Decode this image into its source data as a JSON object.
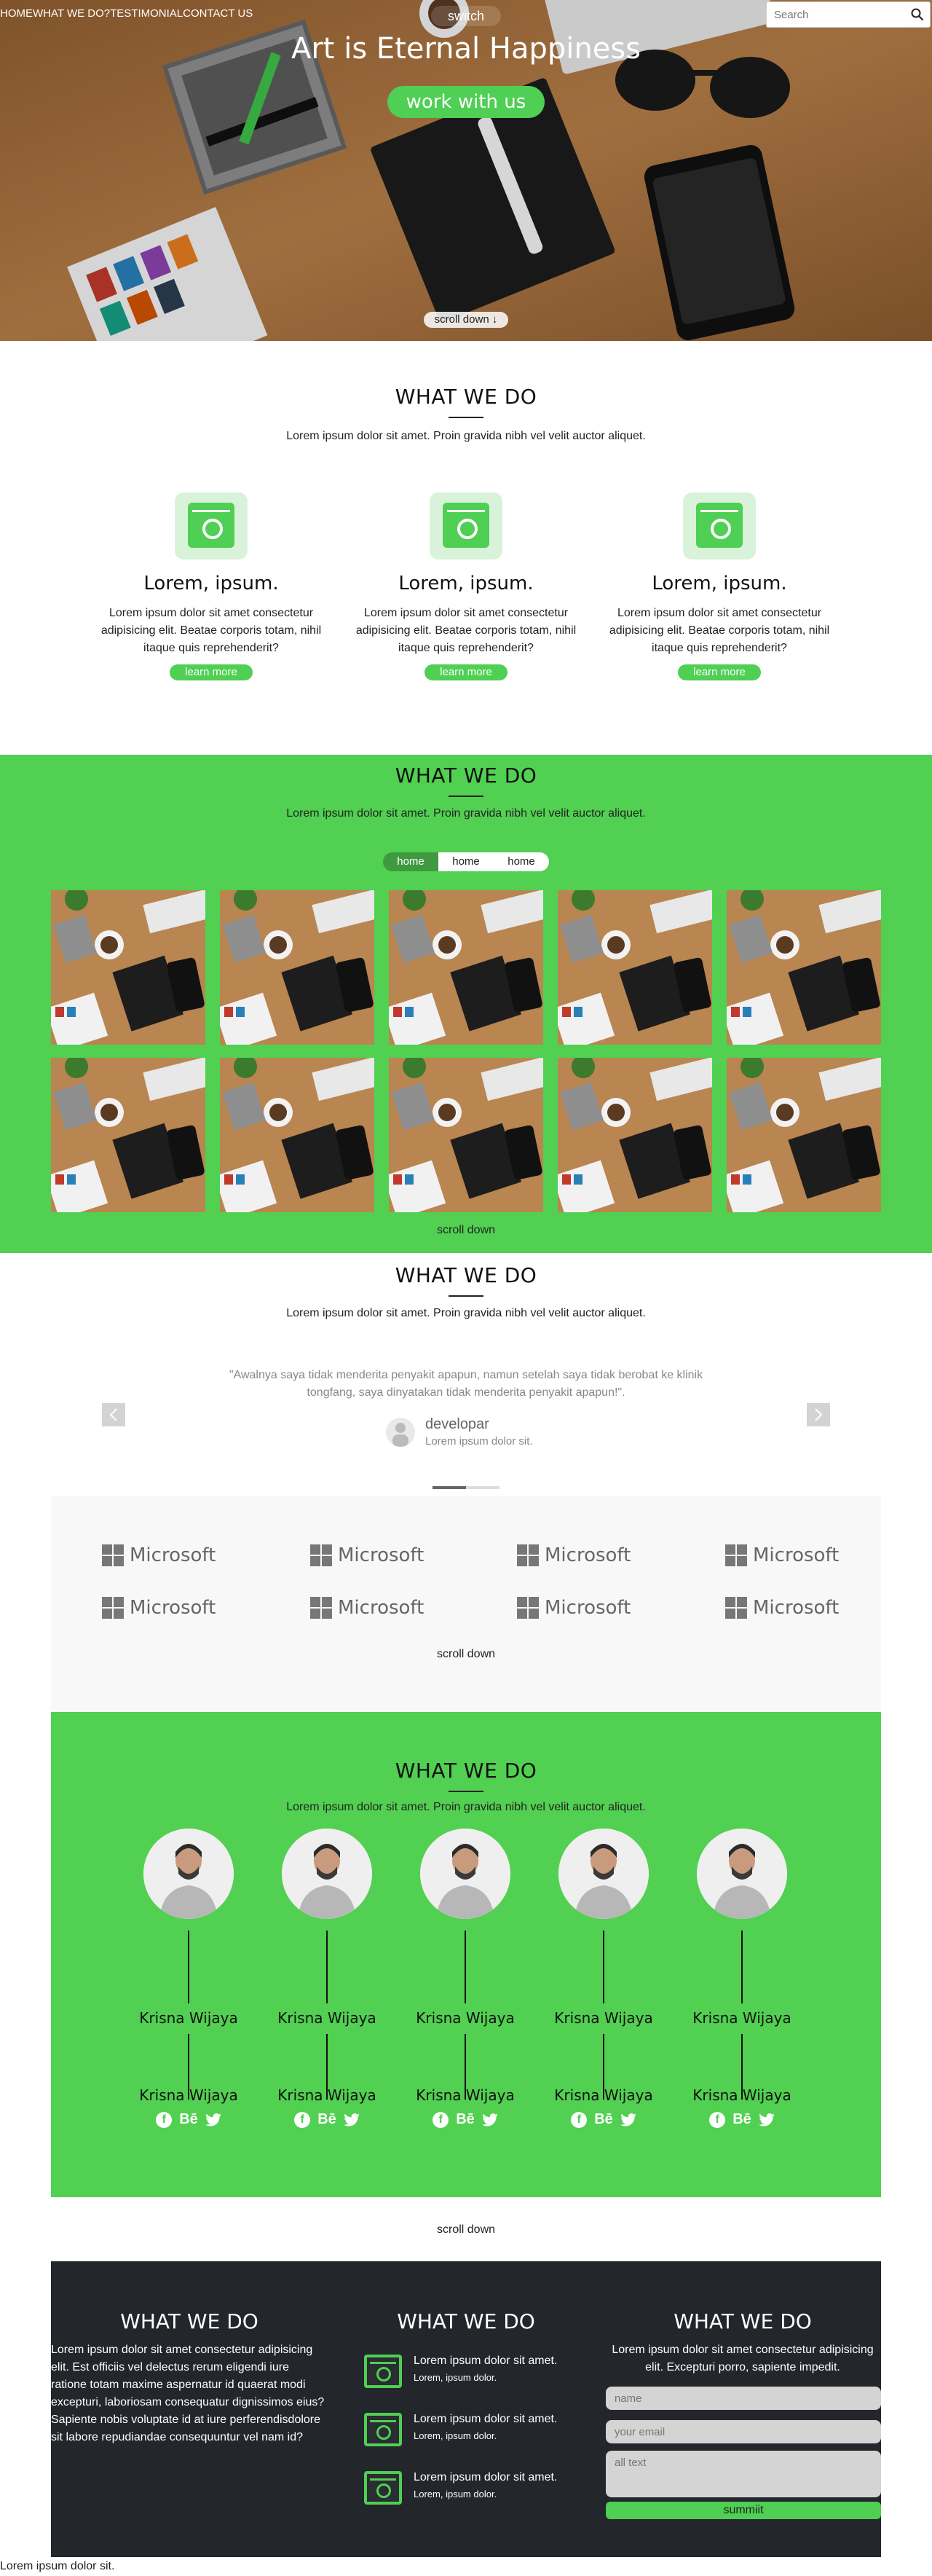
{
  "nav": {
    "links": [
      "HOME",
      "WHAT WE DO?",
      "TESTIMONIAL",
      "CONTACT US"
    ],
    "switch_label": "switch",
    "search_placeholder": "Search"
  },
  "hero": {
    "title": "Art is Eternal Happiness",
    "cta": "work with us",
    "scroll_label": "scroll down"
  },
  "services": {
    "title": "WHAT WE DO",
    "subtitle": "Lorem ipsum dolor sit amet. Proin gravida nibh vel velit auctor aliquet.",
    "items": [
      {
        "title": "Lorem, ipsum.",
        "text": "Lorem ipsum dolor sit amet consectetur adipisicing elit. Beatae corporis totam, nihil itaque quis reprehenderit?",
        "button": "learn more"
      },
      {
        "title": "Lorem, ipsum.",
        "text": "Lorem ipsum dolor sit amet consectetur adipisicing elit. Beatae corporis totam, nihil itaque quis reprehenderit?",
        "button": "learn more"
      },
      {
        "title": "Lorem, ipsum.",
        "text": "Lorem ipsum dolor sit amet consectetur adipisicing elit. Beatae corporis totam, nihil itaque quis reprehenderit?",
        "button": "learn more"
      }
    ]
  },
  "portfolio": {
    "title": "WHAT WE DO",
    "subtitle": "Lorem ipsum dolor sit amet. Proin gravida nibh vel velit auctor aliquet.",
    "filters": [
      "home",
      "home",
      "home"
    ],
    "active_filter": 0,
    "scroll_label": "scroll down"
  },
  "testimonial": {
    "title": "WHAT WE DO",
    "subtitle": "Lorem ipsum dolor sit amet. Proin gravida nibh vel velit auctor aliquet.",
    "quote": "\"Awalnya saya tidak menderita penyakit apapun, namun setelah saya tidak berobat ke klinik tongfang, saya dinyatakan tidak menderita penyakit apapun!\".",
    "name": "developar",
    "role": "Lorem ipsum dolor sit."
  },
  "clients": {
    "logo_text": "Microsoft",
    "scroll_label": "scroll down"
  },
  "team": {
    "title": "WHAT WE DO",
    "subtitle": "Lorem ipsum dolor sit amet. Proin gravida nibh vel velit auctor aliquet.",
    "members": [
      {
        "name_top": "Krisna Wijaya",
        "name_bottom": "Krisna Wijaya"
      },
      {
        "name_top": "Krisna Wijaya",
        "name_bottom": "Krisna Wijaya"
      },
      {
        "name_top": "Krisna Wijaya",
        "name_bottom": "Krisna Wijaya"
      },
      {
        "name_top": "Krisna Wijaya",
        "name_bottom": "Krisna Wijaya"
      },
      {
        "name_top": "Krisna Wijaya",
        "name_bottom": "Krisna Wijaya"
      }
    ],
    "behance_label": "Bē",
    "scroll_label": "scroll down"
  },
  "footer": {
    "col1_title": "WHAT WE DO",
    "col1_text": "Lorem ipsum dolor sit amet consectetur adipisicing elit. Est officiis vel delectus rerum eligendi iure ratione totam maxime aspernatur id quaerat modi excepturi, laboriosam consequatur dignissimos eius? Sapiente nobis voluptate id at iure perferendisdolore sit labore repudiandae consequuntur vel nam id?",
    "col2_title": "WHAT WE DO",
    "col2_items": [
      {
        "main": "Lorem ipsum dolor sit amet.",
        "small": "Lorem, ipsum dolor."
      },
      {
        "main": "Lorem ipsum dolor sit amet.",
        "small": "Lorem, ipsum dolor."
      },
      {
        "main": "Lorem ipsum dolor sit amet.",
        "small": "Lorem, ipsum dolor."
      }
    ],
    "col3_title": "WHAT WE DO",
    "col3_text": "Lorem ipsum dolor sit amet consectetur adipisicing elit. Excepturi porro, sapiente impedit.",
    "name_placeholder": "name",
    "email_placeholder": "your email",
    "text_placeholder": "all text",
    "submit_label": "summiit"
  },
  "bottom_text": "Lorem ipsum dolor sit.",
  "colors": {
    "accent": "#51d051",
    "dark": "#23262b"
  }
}
